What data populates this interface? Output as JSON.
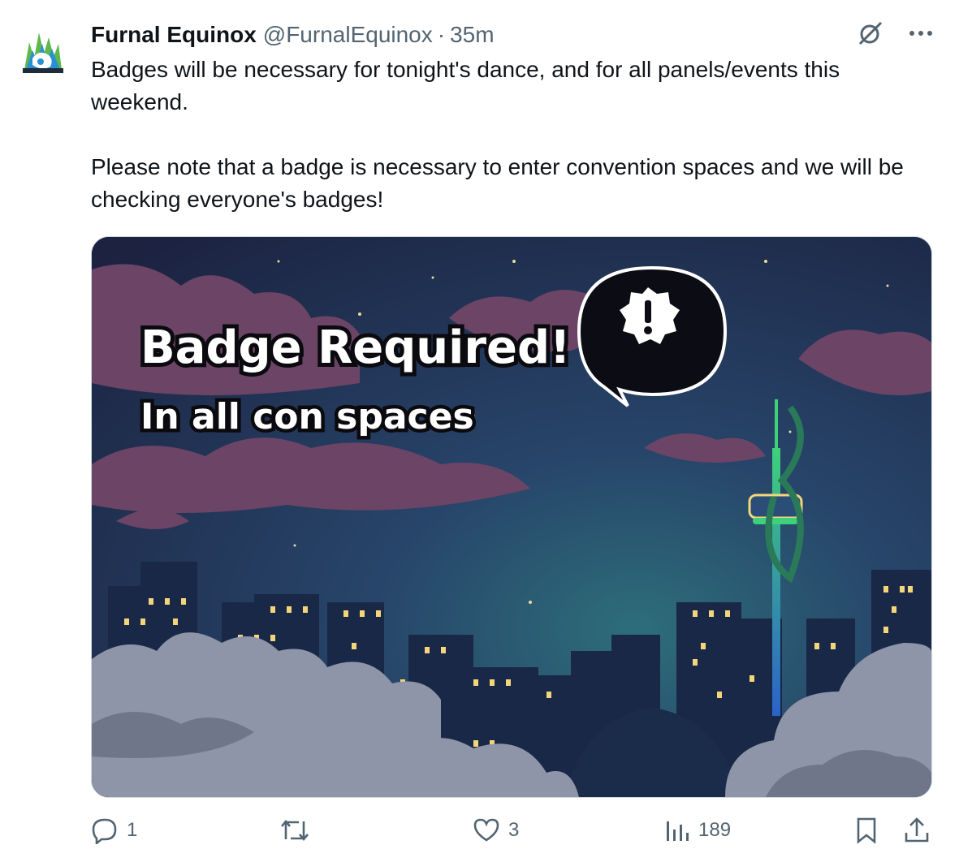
{
  "author": {
    "name": "Furnal Equinox",
    "handle": "@FurnalEquinox",
    "separator": "·",
    "time": "35m"
  },
  "post": {
    "paragraph1": "Badges will be necessary for tonight's dance, and for all panels/events this weekend.",
    "paragraph2": "Please note that a badge is necessary to enter convention spaces and we will be checking everyone's badges!"
  },
  "media": {
    "headline": "Badge Required!",
    "subheadline": "In all con spaces"
  },
  "actions": {
    "replies": "1",
    "reposts": "",
    "likes": "3",
    "views": "189"
  },
  "icons": {
    "top": [
      "grok-icon",
      "more-icon"
    ],
    "actions": [
      "reply-icon",
      "repost-icon",
      "like-icon",
      "views-icon",
      "bookmark-icon",
      "share-icon"
    ]
  },
  "colors": {
    "text": "#0f1419",
    "secondary": "#536471",
    "border": "#cfd9de",
    "sky": "#1f2540",
    "cloud_purple": "#6b4466",
    "tower_glow": "#3fd07a"
  }
}
